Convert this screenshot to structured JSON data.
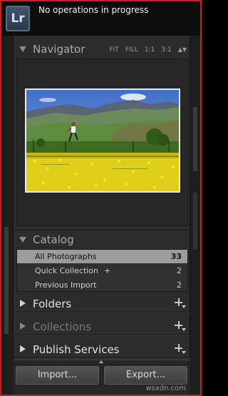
{
  "app": {
    "logo": "Lr",
    "status": "No operations in progress"
  },
  "navigator": {
    "title": "Navigator",
    "zoom_options": [
      "FIT",
      "FILL",
      "1:1",
      "3:1"
    ],
    "zoom_arrows_icon": "updown-arrows-icon"
  },
  "catalog": {
    "title": "Catalog",
    "items": [
      {
        "label": "All Photographs",
        "count": "33",
        "selected": true
      },
      {
        "label": "Quick Collection",
        "suffix": "+",
        "count": "2",
        "selected": false
      },
      {
        "label": "Previous Import",
        "count": "2",
        "selected": false
      }
    ]
  },
  "folders": {
    "title": "Folders"
  },
  "collections": {
    "title": "Collections"
  },
  "publish": {
    "title": "Publish Services"
  },
  "buttons": {
    "import": "Import...",
    "export": "Export..."
  },
  "watermark": "wsxdn.com",
  "colors": {
    "frame": "#c81e1e",
    "selected_row": "#9b9b9b",
    "panel_bg": "#2c2c2c"
  }
}
